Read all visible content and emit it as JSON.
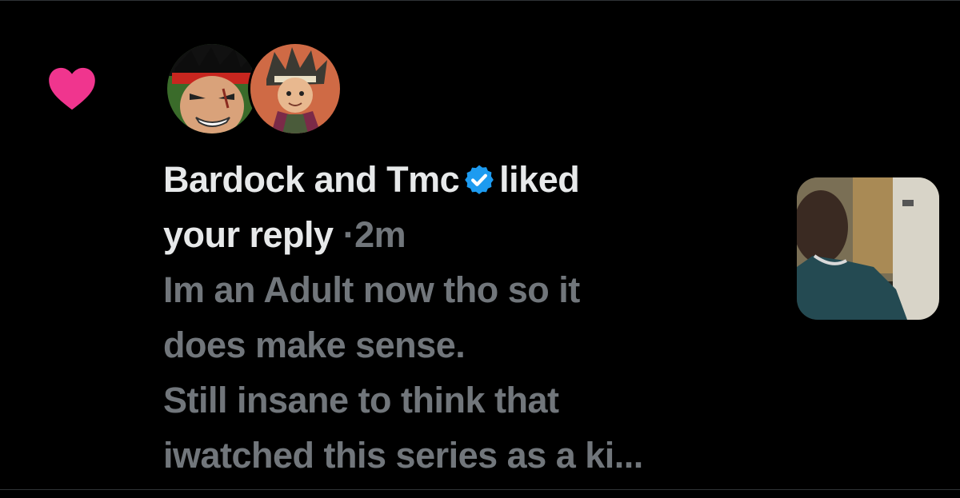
{
  "notification": {
    "type_icon": "heart-icon",
    "accent_color": "#f91880",
    "avatars": [
      {
        "name": "Bardock",
        "icon": "anime-avatar-bardock"
      },
      {
        "name": "Tmc",
        "icon": "anime-avatar-tmc"
      }
    ],
    "user1": "Bardock",
    "conjunction": "and",
    "user2": "Tmc",
    "verified_color": "#1d9bf0",
    "action": "liked",
    "object": "your reply",
    "separator": "·",
    "time": "2m",
    "reply_text": "Im an Adult now tho so it\ndoes make sense.\nStill insane to think that\niwatched this series as a ki...",
    "media_icon": "video-thumbnail"
  }
}
